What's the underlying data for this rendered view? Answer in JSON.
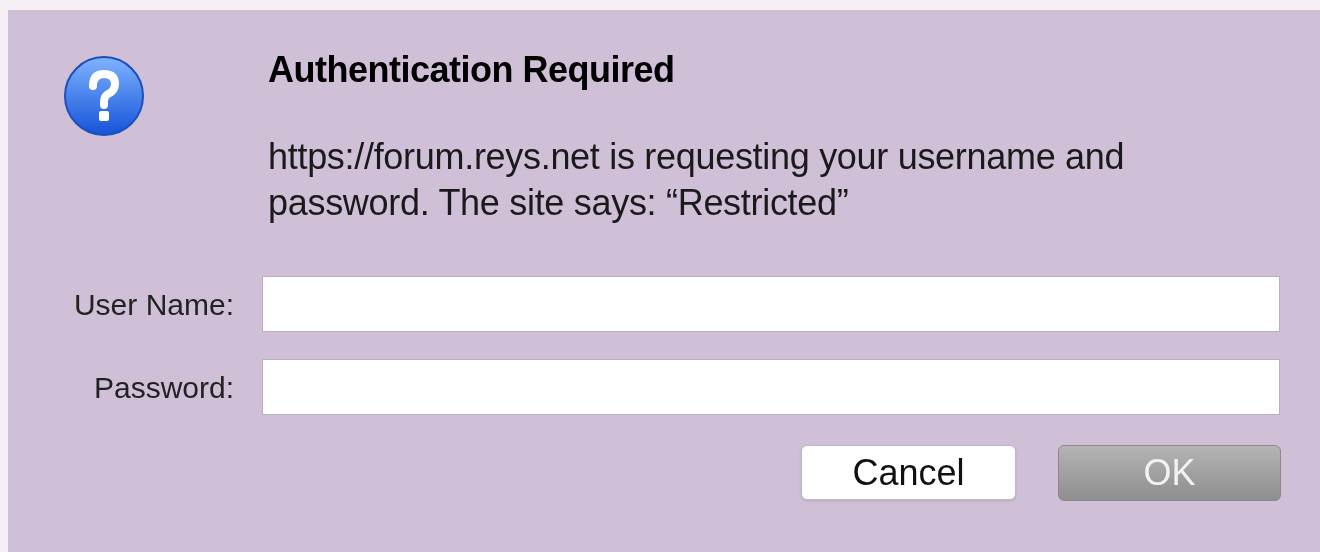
{
  "dialog": {
    "title": "Authentication Required",
    "message": "https://forum.reys.net is requesting your username and password. The site says: “Restricted”"
  },
  "fields": [
    {
      "label": "User Name:"
    },
    {
      "label": "Password:"
    }
  ],
  "buttons": [
    {
      "label": "Cancel",
      "disabled": false
    },
    {
      "label": "OK",
      "disabled": true
    }
  ]
}
